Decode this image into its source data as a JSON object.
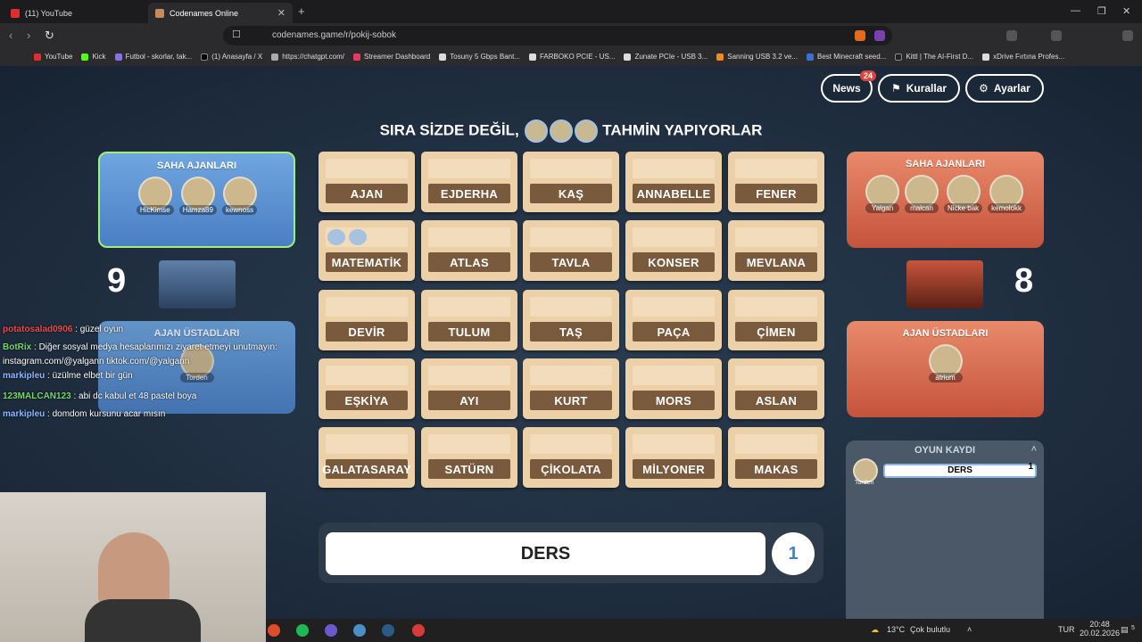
{
  "browser": {
    "tabs": [
      {
        "label": "(11) YouTube",
        "active": false
      },
      {
        "label": "Codenames Online",
        "active": true
      }
    ],
    "url": "codenames.game/r/pokij-sobok",
    "bookmarks": [
      "YouTube",
      "Kick",
      "Futbol - skorlar, tak...",
      "(1) Anasayfa / X",
      "https://chatgpt.com/",
      "Streamer Dashboard",
      "Tosuny 5 Gbps Bant...",
      "FARBOKO PCIE - US...",
      "Zunate PCIe - USB 3...",
      "Sanning USB 3.2 ve...",
      "Best Minecraft seed...",
      "Kittl | The AI-First D...",
      "xDrive Fırtına Profes..."
    ]
  },
  "topbar": {
    "news_label": "News",
    "news_badge": "24",
    "rules_label": "Kurallar",
    "settings_label": "Ayarlar"
  },
  "turn": {
    "prefix": "SIRA SİZDE DEĞİL,",
    "suffix": "TAHMİN YAPIYORLAR",
    "avatars": [
      "HicKimse",
      "Hamza89",
      "kewnoss"
    ]
  },
  "blue_team": {
    "operatives_title": "SAHA AJANLARI",
    "operatives": [
      "HicKimse",
      "Hamza89",
      "kewnoss"
    ],
    "score": "9",
    "spymasters_title": "AJAN ÜSTADLARI",
    "spymasters": [
      "Torden"
    ]
  },
  "red_team": {
    "operatives_title": "SAHA AJANLARI",
    "operatives": [
      "Yalgan",
      "malcan",
      "Nicke bak",
      "kemolokk"
    ],
    "score": "8",
    "spymasters_title": "AJAN ÜSTADLARI",
    "spymasters": [
      "atrium"
    ]
  },
  "board": [
    "AJAN",
    "EJDERHA",
    "KAŞ",
    "ANNABELLE",
    "FENER",
    "MATEMATİK",
    "ATLAS",
    "TAVLA",
    "KONSER",
    "MEVLANA",
    "DEVİR",
    "TULUM",
    "TAŞ",
    "PAÇA",
    "ÇİMEN",
    "EŞKİYA",
    "AYI",
    "KURT",
    "MORS",
    "ASLAN",
    "GALATASARAY",
    "SATÜRN",
    "ÇİKOLATA",
    "MİLYONER",
    "MAKAS"
  ],
  "card_marks": {
    "MATEMATİK": [
      "kewnoss",
      "Hamza89"
    ]
  },
  "clue": {
    "word": "DERS",
    "number": "1"
  },
  "log": {
    "title": "OYUN KAYDI",
    "entries": [
      {
        "player": "Torden",
        "word": "DERS",
        "number": "1"
      }
    ]
  },
  "chat": [
    {
      "user": "potatosalad0906",
      "msg": ": güzel oyun",
      "color": "#e94b4b"
    },
    {
      "user": "BotRix",
      "msg": ": Diğer sosyal medya hesaplarımızı ziyaret etmeyi unutmayın:",
      "color": "#7bd36a"
    },
    {
      "user": "",
      "msg": "instagram.com/@yalgann tiktok.com/@yalgann",
      "color": "#ffffff"
    },
    {
      "user": "markipleu",
      "msg": ": üzülme elbet bir gün",
      "color": "#8fb7ff"
    },
    {
      "user": "123MALCAN123",
      "msg": ": abi dc kabul et 48 pastel boya",
      "color": "#7bd36a"
    },
    {
      "user": "markipleu",
      "msg": ": domdom kursunu acar mısın",
      "color": "#8fb7ff"
    }
  ],
  "taskbar": {
    "weather": "13°C",
    "weather_desc": "Çok bulutlu",
    "lang": "TUR",
    "time": "20:48",
    "date": "20.02.2026",
    "notif": "5"
  }
}
